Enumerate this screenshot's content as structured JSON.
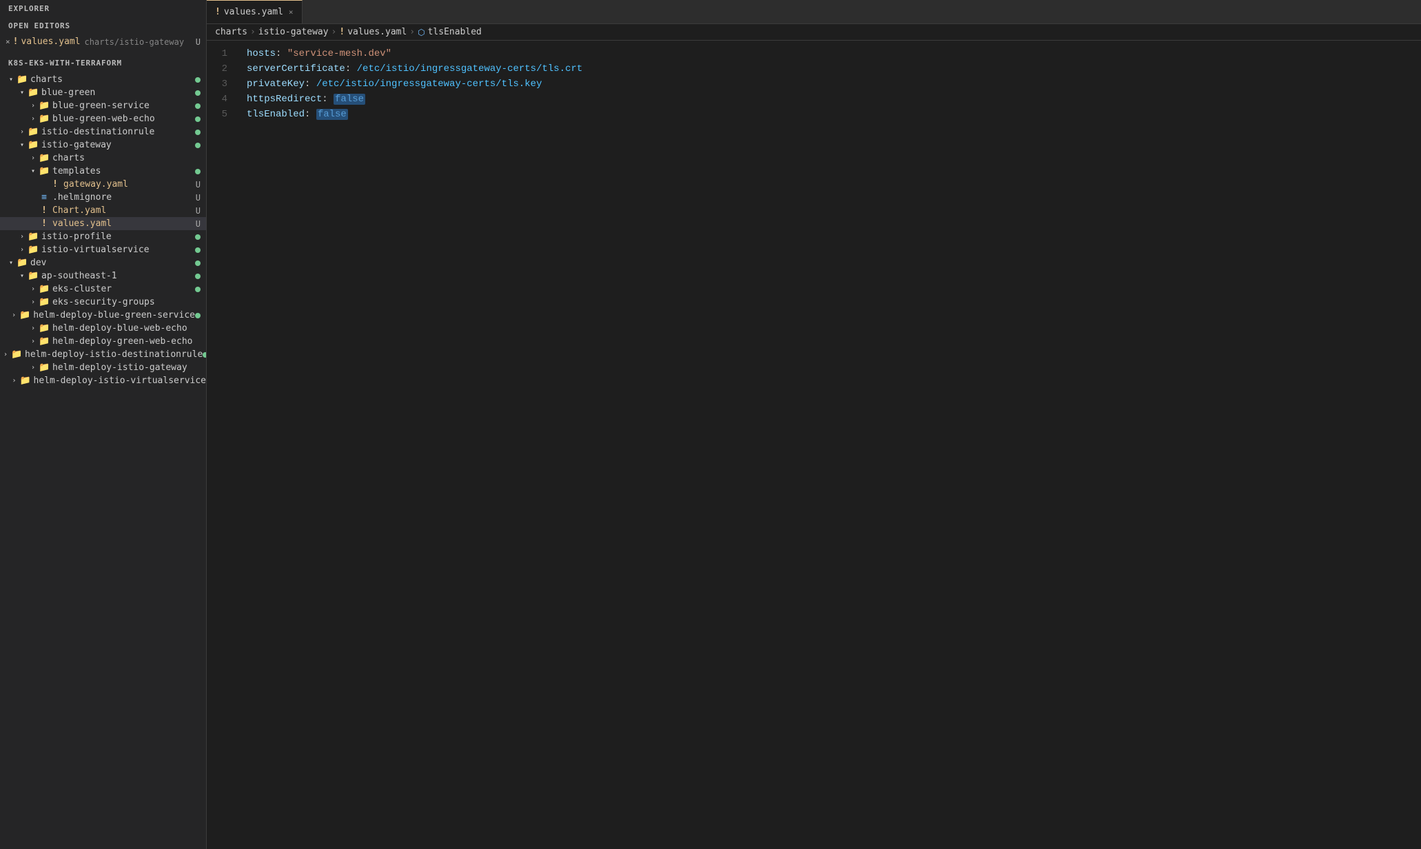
{
  "sidebar": {
    "explorer_label": "EXPLORER",
    "open_editors_label": "OPEN EDITORS",
    "open_editors": [
      {
        "close": "×",
        "exclaim": "!",
        "filename": "values.yaml",
        "filepath": "charts/istio-gateway",
        "badge": "U"
      }
    ],
    "workspace_label": "K8S-EKS-WITH-TERRAFORM",
    "tree": [
      {
        "id": "charts",
        "level": 0,
        "chevron": "▾",
        "icon_type": "folder",
        "label": "charts",
        "dot": true,
        "badge": ""
      },
      {
        "id": "blue-green",
        "level": 1,
        "chevron": "▾",
        "icon_type": "folder",
        "label": "blue-green",
        "dot": true,
        "badge": ""
      },
      {
        "id": "blue-green-service",
        "level": 2,
        "chevron": "›",
        "icon_type": "folder",
        "label": "blue-green-service",
        "dot": true,
        "badge": ""
      },
      {
        "id": "blue-green-web-echo",
        "level": 2,
        "chevron": "›",
        "icon_type": "folder",
        "label": "blue-green-web-echo",
        "dot": true,
        "badge": ""
      },
      {
        "id": "istio-destinationrule",
        "level": 1,
        "chevron": "›",
        "icon_type": "folder",
        "label": "istio-destinationrule",
        "dot": true,
        "badge": ""
      },
      {
        "id": "istio-gateway",
        "level": 1,
        "chevron": "▾",
        "icon_type": "folder",
        "label": "istio-gateway",
        "dot": true,
        "badge": ""
      },
      {
        "id": "charts-sub",
        "level": 2,
        "chevron": "›",
        "icon_type": "folder",
        "label": "charts",
        "dot": false,
        "badge": ""
      },
      {
        "id": "templates",
        "level": 2,
        "chevron": "▾",
        "icon_type": "folder",
        "label": "templates",
        "dot": true,
        "badge": ""
      },
      {
        "id": "gateway.yaml",
        "level": 3,
        "chevron": "",
        "icon_type": "exclaim",
        "label": "gateway.yaml",
        "dot": false,
        "badge": "U"
      },
      {
        "id": ".helmignore",
        "level": 2,
        "chevron": "",
        "icon_type": "lines",
        "label": ".helmignore",
        "dot": false,
        "badge": "U"
      },
      {
        "id": "Chart.yaml",
        "level": 2,
        "chevron": "",
        "icon_type": "exclaim",
        "label": "Chart.yaml",
        "dot": false,
        "badge": "U"
      },
      {
        "id": "values.yaml",
        "level": 2,
        "chevron": "",
        "icon_type": "exclaim",
        "label": "values.yaml",
        "dot": false,
        "badge": "U",
        "selected": true
      },
      {
        "id": "istio-profile",
        "level": 1,
        "chevron": "›",
        "icon_type": "folder",
        "label": "istio-profile",
        "dot": true,
        "badge": ""
      },
      {
        "id": "istio-virtualservice",
        "level": 1,
        "chevron": "›",
        "icon_type": "folder",
        "label": "istio-virtualservice",
        "dot": true,
        "badge": ""
      },
      {
        "id": "dev",
        "level": 0,
        "chevron": "▾",
        "icon_type": "folder",
        "label": "dev",
        "dot": true,
        "badge": ""
      },
      {
        "id": "ap-southeast-1",
        "level": 1,
        "chevron": "▾",
        "icon_type": "folder",
        "label": "ap-southeast-1",
        "dot": true,
        "badge": ""
      },
      {
        "id": "eks-cluster",
        "level": 2,
        "chevron": "›",
        "icon_type": "folder",
        "label": "eks-cluster",
        "dot": true,
        "badge": ""
      },
      {
        "id": "eks-security-groups",
        "level": 2,
        "chevron": "›",
        "icon_type": "folder",
        "label": "eks-security-groups",
        "dot": false,
        "badge": ""
      },
      {
        "id": "helm-deploy-blue-green-service",
        "level": 2,
        "chevron": "›",
        "icon_type": "folder",
        "label": "helm-deploy-blue-green-service",
        "dot": true,
        "badge": ""
      },
      {
        "id": "helm-deploy-blue-web-echo",
        "level": 2,
        "chevron": "›",
        "icon_type": "folder",
        "label": "helm-deploy-blue-web-echo",
        "dot": false,
        "badge": ""
      },
      {
        "id": "helm-deploy-green-web-echo",
        "level": 2,
        "chevron": "›",
        "icon_type": "folder",
        "label": "helm-deploy-green-web-echo",
        "dot": false,
        "badge": ""
      },
      {
        "id": "helm-deploy-istio-destinationrule",
        "level": 2,
        "chevron": "›",
        "icon_type": "folder",
        "label": "helm-deploy-istio-destinationrule",
        "dot": true,
        "badge": ""
      },
      {
        "id": "helm-deploy-istio-gateway",
        "level": 2,
        "chevron": "›",
        "icon_type": "folder",
        "label": "helm-deploy-istio-gateway",
        "dot": false,
        "badge": ""
      },
      {
        "id": "helm-deploy-istio-virtualservice",
        "level": 2,
        "chevron": "›",
        "icon_type": "folder",
        "label": "helm-deploy-istio-virtualservice",
        "dot": false,
        "badge": ""
      }
    ]
  },
  "editor": {
    "tab_filename": "values.yaml",
    "breadcrumb": [
      "charts",
      "istio-gateway",
      "values.yaml",
      "tlsEnabled"
    ],
    "lines": [
      {
        "num": "1",
        "key": "hosts",
        "sep": ": ",
        "value_type": "string",
        "value": "\"service-mesh.dev\""
      },
      {
        "num": "2",
        "key": "serverCertificate",
        "sep": ": ",
        "value_type": "path",
        "value": "/etc/istio/ingressgateway-certs/tls.crt"
      },
      {
        "num": "3",
        "key": "privateKey",
        "sep": ": ",
        "value_type": "path",
        "value": "/etc/istio/ingressgateway-certs/tls.key"
      },
      {
        "num": "4",
        "key": "httpsRedirect",
        "sep": ": ",
        "value_type": "bool",
        "value": "false"
      },
      {
        "num": "5",
        "key": "tlsEnabled",
        "sep": ": ",
        "value_type": "bool",
        "value": "false"
      }
    ]
  }
}
